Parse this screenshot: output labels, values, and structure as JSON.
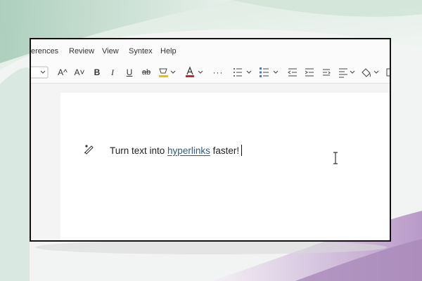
{
  "menu": {
    "items": [
      "erences",
      "Review",
      "View",
      "Syntex",
      "Help"
    ]
  },
  "toolbar": {
    "grow_font": "A^",
    "shrink_font": "A˅",
    "bold": "B",
    "italic": "I",
    "underline": "U",
    "strikethrough": "ab",
    "more": "···",
    "font_color": "#c62828",
    "highlight_color": "#e6c200"
  },
  "document": {
    "text_before": "Turn text into ",
    "link_text": "hyperlinks",
    "text_after": " faster!"
  },
  "colors": {
    "link": "#2f5d7c"
  }
}
